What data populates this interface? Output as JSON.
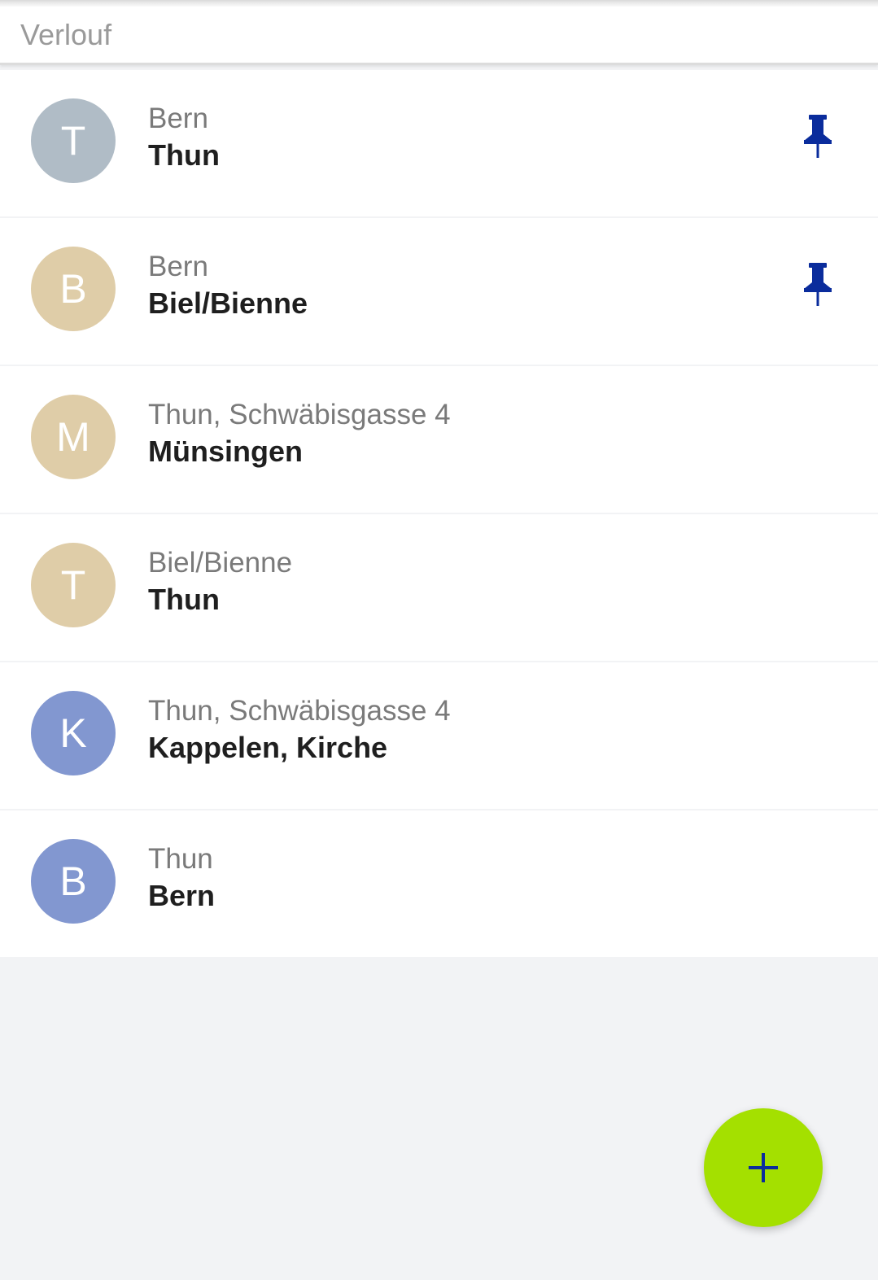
{
  "header": {
    "title": "Verlouf"
  },
  "colors": {
    "pin": "#0a2c9c",
    "fab": "#a4e000",
    "fab_icon": "#0a2c9c"
  },
  "connections": [
    {
      "initial": "T",
      "from": "Bern",
      "to": "Thun",
      "pinned": true,
      "avatar_color": "#b0bcc6",
      "pin_icon": "pin-icon"
    },
    {
      "initial": "B",
      "from": "Bern",
      "to": "Biel/Bienne",
      "pinned": true,
      "avatar_color": "#dfcda8",
      "pin_icon": "pin-icon"
    },
    {
      "initial": "M",
      "from": "Thun, Schwäbisgasse 4",
      "to": "Münsingen",
      "pinned": false,
      "avatar_color": "#dfcda8"
    },
    {
      "initial": "T",
      "from": "Biel/Bienne",
      "to": "Thun",
      "pinned": false,
      "avatar_color": "#dfcda8"
    },
    {
      "initial": "K",
      "from": "Thun, Schwäbisgasse 4",
      "to": "Kappelen, Kirche",
      "pinned": false,
      "avatar_color": "#8297d0"
    },
    {
      "initial": "B",
      "from": "Thun",
      "to": "Bern",
      "pinned": false,
      "avatar_color": "#8297d0"
    }
  ],
  "fab": {
    "icon": "plus-icon"
  }
}
